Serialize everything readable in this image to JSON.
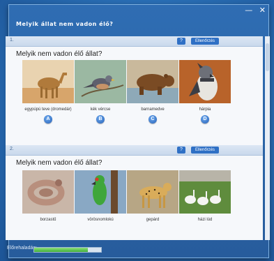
{
  "window": {
    "title": "Melyik állat nem vadon élő?",
    "minimize_glyph": "—",
    "close_glyph": "✕"
  },
  "questions": [
    {
      "number": "1.",
      "help_label": "?",
      "check_label": "Ellenőrzés",
      "text": "Melyik nem vadon élő állat?",
      "options": [
        {
          "label": "egypúpú teve (dromedár)",
          "letter": "A",
          "image": "camel"
        },
        {
          "label": "kék vércse",
          "letter": "B",
          "image": "falcon"
        },
        {
          "label": "barnamedve",
          "letter": "C",
          "image": "bear"
        },
        {
          "label": "hárpia",
          "letter": "D",
          "image": "harpy-eagle"
        }
      ]
    },
    {
      "number": "2.",
      "help_label": "?",
      "check_label": "Ellenőrzés",
      "text": "Melyik nem vadon élő állat?",
      "options": [
        {
          "label": "borzastű",
          "image": "snake"
        },
        {
          "label": "vörösnomlokú",
          "image": "parrot"
        },
        {
          "label": "gepárd",
          "image": "cheetah"
        },
        {
          "label": "házi lúd",
          "image": "geese"
        }
      ]
    }
  ],
  "footer": {
    "progress_label": "Előrehaladás:",
    "progress": 0.8,
    "progress_color": "#3fae39"
  }
}
